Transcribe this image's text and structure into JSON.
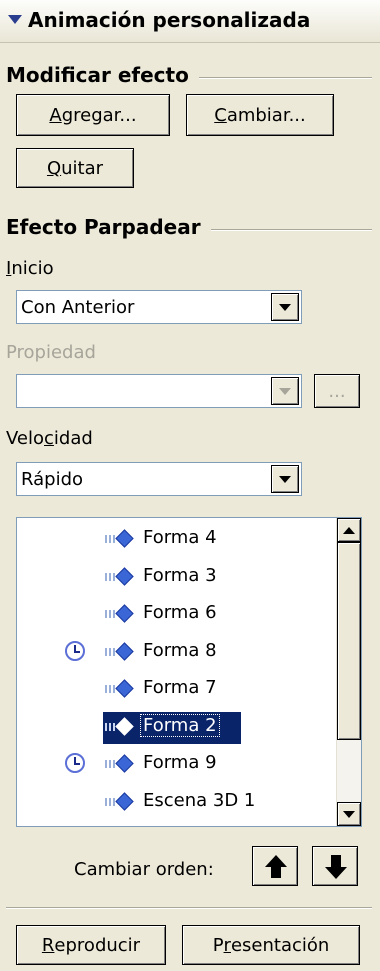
{
  "panel": {
    "title": "Animación personalizada"
  },
  "modificar": {
    "section_title": "Modificar efecto",
    "agregar_pre": "",
    "agregar_key": "A",
    "agregar_post": "gregar...",
    "cambiar_pre": "",
    "cambiar_key": "C",
    "cambiar_post": "ambiar...",
    "quitar_pre": "",
    "quitar_key": "Q",
    "quitar_post": "uitar"
  },
  "efecto": {
    "section_title": "Efecto Parpadear",
    "inicio_label_key": "I",
    "inicio_label_rest": "nicio",
    "inicio_value": "Con Anterior",
    "propiedad_label": "Propiedad",
    "propiedad_value": "",
    "propiedad_more": "...",
    "velocidad_label_pre": "Velo",
    "velocidad_label_key": "c",
    "velocidad_label_post": "idad",
    "velocidad_value": "Rápido"
  },
  "animation_list": {
    "items": [
      {
        "name": "Forma 4",
        "clock": false,
        "selected": false
      },
      {
        "name": "Forma 3",
        "clock": false,
        "selected": false
      },
      {
        "name": "Forma 6",
        "clock": false,
        "selected": false
      },
      {
        "name": "Forma 8",
        "clock": true,
        "selected": false
      },
      {
        "name": "Forma 7",
        "clock": false,
        "selected": false
      },
      {
        "name": "Forma 2",
        "clock": false,
        "selected": true
      },
      {
        "name": "Forma 9",
        "clock": true,
        "selected": false
      },
      {
        "name": "Escena 3D 1",
        "clock": false,
        "selected": false
      }
    ]
  },
  "reorder": {
    "label": "Cambiar orden:"
  },
  "footer": {
    "reproducir_key": "R",
    "reproducir_rest": "eproducir",
    "presentacion_pre": "P",
    "presentacion_key": "r",
    "presentacion_post": "esentación"
  }
}
